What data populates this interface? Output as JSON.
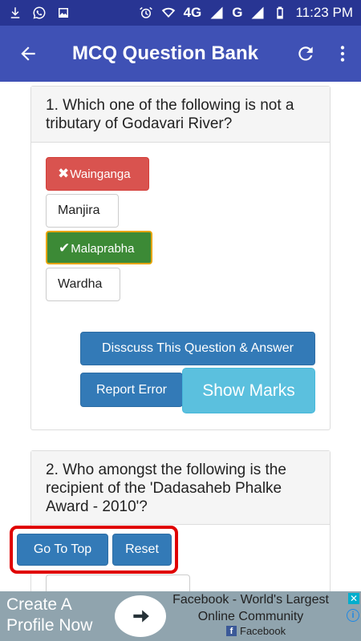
{
  "status_bar": {
    "network": "4G",
    "network2": "G",
    "time": "11:23 PM"
  },
  "app_bar": {
    "title": "MCQ Question Bank",
    "back_icon": "arrow-back-icon",
    "refresh_icon": "refresh-icon",
    "menu_icon": "more-vert-icon"
  },
  "questions": [
    {
      "text": "1. Which one of the following is not a tributary of Godavari River?",
      "options": [
        {
          "label": "Wainganga",
          "state": "wrong",
          "mark": "✖"
        },
        {
          "label": "Manjira",
          "state": "none"
        },
        {
          "label": "Malaprabha",
          "state": "correct",
          "mark": "✔"
        },
        {
          "label": "Wardha",
          "state": "none"
        }
      ],
      "discuss_label": "Disscuss This Question & Answer",
      "report_label": "Report Error",
      "show_marks_label": "Show Marks"
    },
    {
      "text": "2. Who amongst the following is the recipient of the 'Dadasaheb Phalke Award - 2010'?"
    }
  ],
  "floating": {
    "go_to_top_label": "Go To Top",
    "reset_label": "Reset"
  },
  "ad": {
    "cta": "Create A Profile Now",
    "headline": "Facebook - World's Largest Online Community",
    "brand": "Facebook",
    "colors": {
      "background": "#90a4ae",
      "brand_blue": "#3b5998"
    }
  },
  "colors": {
    "status_bar": "#283593",
    "app_bar": "#3f51b5",
    "wrong": "#d9534f",
    "correct": "#3c8a36",
    "primary_button": "#337ab7",
    "info_button": "#5bc0de",
    "highlight_border": "#e00000"
  }
}
